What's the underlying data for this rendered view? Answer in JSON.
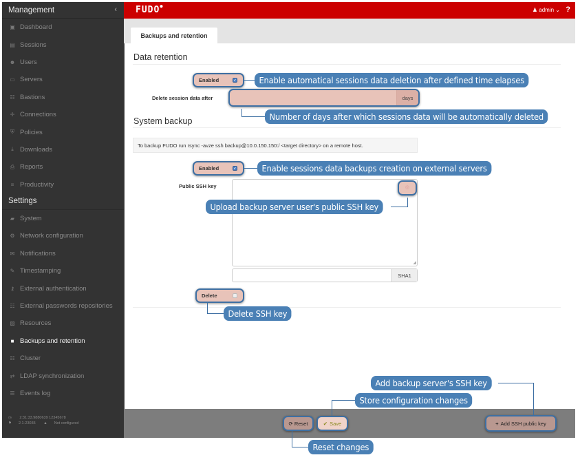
{
  "sidebar": {
    "management_title": "Management",
    "collapse_icon": "chevron-left-icon",
    "management_items": [
      {
        "label": "Dashboard",
        "icon": "chart-icon"
      },
      {
        "label": "Sessions",
        "icon": "film-icon"
      },
      {
        "label": "Users",
        "icon": "users-icon"
      },
      {
        "label": "Servers",
        "icon": "server-icon"
      },
      {
        "label": "Bastions",
        "icon": "sitemap-icon"
      },
      {
        "label": "Connections",
        "icon": "arrows-icon"
      },
      {
        "label": "Policies",
        "icon": "shield-icon"
      },
      {
        "label": "Downloads",
        "icon": "download-icon"
      },
      {
        "label": "Reports",
        "icon": "print-icon"
      },
      {
        "label": "Productivity",
        "icon": "bars-icon"
      }
    ],
    "settings_title": "Settings",
    "settings_items": [
      {
        "label": "System",
        "icon": "folder-icon"
      },
      {
        "label": "Network configuration",
        "icon": "cogs-icon"
      },
      {
        "label": "Notifications",
        "icon": "envelope-icon"
      },
      {
        "label": "Timestamping",
        "icon": "edit-icon"
      },
      {
        "label": "External authentication",
        "icon": "key-icon"
      },
      {
        "label": "External passwords repositories",
        "icon": "grid-icon"
      },
      {
        "label": "Resources",
        "icon": "image-icon"
      },
      {
        "label": "Backups and retention",
        "icon": "archive-icon",
        "active": true
      },
      {
        "label": "Cluster",
        "icon": "sitemap-icon"
      },
      {
        "label": "LDAP synchronization",
        "icon": "exchange-icon"
      },
      {
        "label": "Events log",
        "icon": "list-icon"
      }
    ],
    "footer": {
      "time": "2:31:33.9880639 12345678",
      "version": "2.1-23035",
      "cluster_status": "Not configured"
    }
  },
  "topbar": {
    "logo": "FUDO",
    "user": "admin",
    "help": "?",
    "brand_color": "#cc0000"
  },
  "tabs": [
    {
      "label": "Backups and retention",
      "active": true
    }
  ],
  "retention": {
    "title": "Data retention",
    "enabled_label": "Enabled",
    "enabled_checked": true,
    "delete_after_label": "Delete session data after",
    "delete_after_value": "",
    "delete_after_unit": "days"
  },
  "backup": {
    "title": "System backup",
    "info": "To backup FUDO run rsync -avze ssh backup@10.0.150.150:/ <target directory> on a remote host.",
    "enabled_label": "Enabled",
    "enabled_checked": true,
    "ssh_key_label": "Public SSH key",
    "ssh_key_value": "",
    "fingerprint_value": "",
    "fingerprint_unit": "SHA1",
    "delete_label": "Delete",
    "delete_checked": false
  },
  "footer": {
    "reset_label": "Reset",
    "save_label": "Save",
    "add_key_label": "Add SSH public key"
  },
  "callouts": {
    "retention_enabled": "Enable automatical sessions data deletion after defined time elapses",
    "retention_days": "Number of days after which sessions data will be automatically deleted",
    "backup_enabled": "Enable sessions data backups creation on external servers",
    "upload_key": "Upload backup server user's public SSH key",
    "delete_key": "Delete SSH key",
    "add_key": "Add backup server's SSH key",
    "save": "Store configuration changes",
    "reset": "Reset changes"
  },
  "colors": {
    "callout": "#4a80b5",
    "highlight": "#e8c3b9",
    "sidebar": "#333333"
  }
}
